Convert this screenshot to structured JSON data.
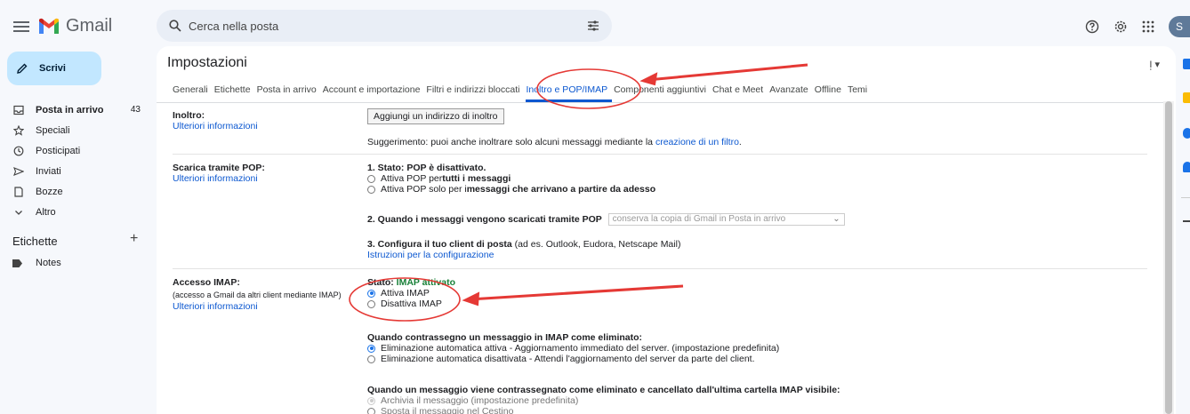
{
  "header": {
    "app_name": "Gmail",
    "search_placeholder": "Cerca nella posta",
    "avatar_letter": "S"
  },
  "sidebar": {
    "compose_label": "Scrivi",
    "items": [
      {
        "label": "Posta in arrivo",
        "count": "43",
        "icon": "inbox-icon"
      },
      {
        "label": "Speciali",
        "count": "",
        "icon": "star-icon"
      },
      {
        "label": "Posticipati",
        "count": "",
        "icon": "clock-icon"
      },
      {
        "label": "Inviati",
        "count": "",
        "icon": "send-icon"
      },
      {
        "label": "Bozze",
        "count": "",
        "icon": "draft-icon"
      },
      {
        "label": "Altro",
        "count": "",
        "icon": "chevron-down-icon"
      }
    ],
    "labels_title": "Etichette",
    "labels": [
      {
        "label": "Notes"
      }
    ]
  },
  "settings": {
    "title": "Impostazioni",
    "input_tools": "I̩",
    "tabs": [
      "Generali",
      "Etichette",
      "Posta in arrivo",
      "Account e importazione",
      "Filtri e indirizzi bloccati",
      "Inoltro e POP/IMAP",
      "Componenti aggiuntivi",
      "Chat e Meet",
      "Avanzate",
      "Offline",
      "Temi"
    ],
    "active_tab": "Inoltro e POP/IMAP",
    "forwarding": {
      "label": "Inoltro:",
      "learn_more": "Ulteriori informazioni",
      "add_button": "Aggiungi un indirizzo di inoltro",
      "tip_prefix": "Suggerimento: puoi anche inoltrare solo alcuni messaggi mediante la ",
      "tip_link": "creazione di un filtro",
      "tip_suffix": "."
    },
    "pop": {
      "label": "Scarica tramite POP:",
      "learn_more": "Ulteriori informazioni",
      "status_title": "1. Stato: POP è disattivato.",
      "opt1_prefix": "Attiva POP per ",
      "opt1_bold": "tutti i messaggi",
      "opt2_prefix": "Attiva POP solo per i ",
      "opt2_bold": "messaggi che arrivano a partire da adesso",
      "q2_label": "2. Quando i messaggi vengono scaricati tramite POP",
      "q2_select": "conserva la copia di Gmail in Posta in arrivo",
      "q3_label": "3. Configura il tuo client di posta",
      "q3_suffix": " (ad es. Outlook, Eudora, Netscape Mail)",
      "q3_link": "Istruzioni per la configurazione"
    },
    "imap": {
      "label": "Accesso IMAP:",
      "sub": "(accesso a Gmail da altri client mediante IMAP)",
      "learn_more": "Ulteriori informazioni",
      "status_prefix": "Stato: ",
      "status_value": "IMAP attivato",
      "enable": "Attiva IMAP",
      "disable": "Disattiva IMAP",
      "deleted_title": "Quando contrassegno un messaggio in IMAP come eliminato:",
      "deleted_opt1": "Eliminazione automatica attiva - Aggiornamento immediato del server. (impostazione predefinita)",
      "deleted_opt2": "Eliminazione automatica disattivata - Attendi l'aggiornamento del server da parte del client.",
      "expunge_title": "Quando un messaggio viene contrassegnato come eliminato e cancellato dall'ultima cartella IMAP visibile:",
      "expunge_opt1": "Archivia il messaggio (impostazione predefinita)",
      "expunge_opt2": "Sposta il messaggio nel Cestino"
    }
  },
  "colors": {
    "accent": "#0b57d0",
    "compose_bg": "#c2e7ff",
    "annotation": "#e53935",
    "imap_status": "#188038"
  }
}
